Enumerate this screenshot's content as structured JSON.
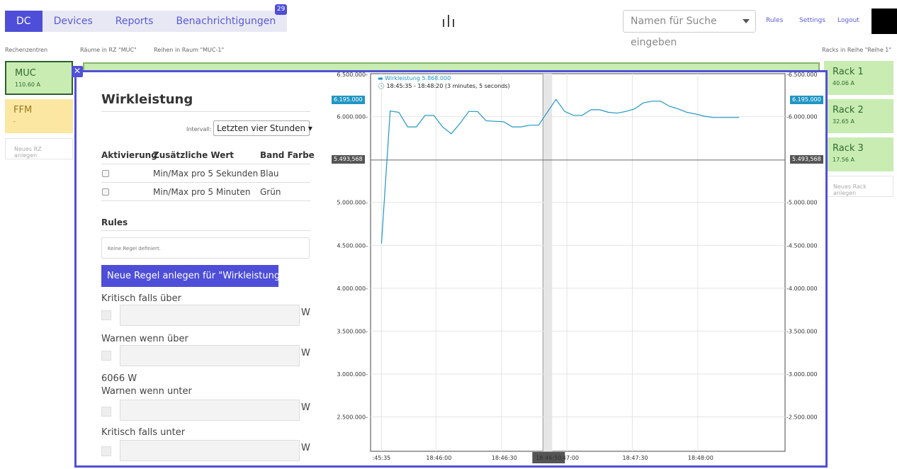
{
  "nav": {
    "tabs": [
      {
        "label": "DC",
        "active": true
      },
      {
        "label": "Devices"
      },
      {
        "label": "Reports"
      },
      {
        "label": "Benachrichtigungen",
        "badge": "29"
      }
    ],
    "search_placeholder": "Namen für Suche eingeben",
    "links": [
      "Rules",
      "Settings",
      "Logout"
    ]
  },
  "columns": {
    "rechenzentren_label": "Rechenzentren",
    "raeume_label": "Räume in RZ \"MUC\"",
    "reihen_label": "Reihen in Raum \"MUC-1\"",
    "racks_label": "Racks in Reihe \"Reihe 1\""
  },
  "datacenters": [
    {
      "name": "MUC",
      "value": "110.60 A",
      "color": "#c8ecb2"
    },
    {
      "name": "FFM",
      "value": "-",
      "color": "#fbe7a1"
    }
  ],
  "new_dc_label": "Neues RZ anlegen",
  "racks": [
    {
      "name": "Rack 1",
      "value": "40.06 A"
    },
    {
      "name": "Rack 2",
      "value": "32.65 A"
    },
    {
      "name": "Rack 3",
      "value": "17.56 A"
    }
  ],
  "new_rack_label": "Neues Rack anlegen",
  "panel": {
    "title": "Wirkleistung",
    "interval_label": "Intervall:",
    "interval_value": "Letzten vier Stunden",
    "table_headers": [
      "Aktivierung",
      "Zusätzliche Wert",
      "Band Farbe"
    ],
    "table_rows": [
      {
        "value": "Min/Max pro 5 Sekunden",
        "color": "Blau"
      },
      {
        "value": "Min/Max pro 5 Minuten",
        "color": "Grün"
      }
    ],
    "rules_title": "Rules",
    "no_rule_text": "Keine Regel definiert.",
    "new_rule_button": "Neue Regel anlegen für \"Wirkleistung\"",
    "thresholds": [
      {
        "label": "Kritisch falls über",
        "unit": "W"
      },
      {
        "label": "Warnen wenn über",
        "unit": "W"
      },
      {
        "label": "Warnen wenn unter",
        "unit": "W"
      },
      {
        "label": "Kritisch falls unter",
        "unit": "W"
      }
    ],
    "current_value": "6066 W"
  },
  "chart_data": {
    "type": "line",
    "series_color": "#2196c4",
    "legend": {
      "name": "Wirkleistung",
      "value": "5.868.000",
      "range": "18:45:35 - 18:48:20  (3 minutes, 5 seconds)"
    },
    "yticks": [
      "6.000.000",
      "5.000.000",
      "4.500.000",
      "4.000.000",
      "3.500.000",
      "3.000.000",
      "2.500.000"
    ],
    "ytick_values": [
      6000000,
      5000000,
      4500000,
      4000000,
      3500000,
      3000000,
      2500000
    ],
    "ytop_label": "6.500.000",
    "xticks": [
      ":45:35",
      "18:46:00",
      "18:46:30",
      "18:46:50",
      ":47:00",
      "18:47:30",
      "18:48:00"
    ],
    "xtick_seconds": [
      5,
      30,
      60,
      80,
      90,
      120,
      150
    ],
    "ylim": [
      2100000,
      6500000
    ],
    "xlim_seconds": [
      0,
      190
    ],
    "max_flag": "6.195.000",
    "cursor_flag": "5.493,568",
    "cursor_value": 5493568,
    "cursor_x": "18:46:50",
    "x_seconds": [
      5,
      9,
      13,
      17,
      21,
      25,
      29,
      33,
      37,
      41,
      45,
      49,
      53,
      57,
      61,
      65,
      69,
      73,
      77,
      81,
      85,
      89,
      93,
      97,
      101,
      105,
      109,
      113,
      117,
      121,
      125,
      129,
      133,
      137,
      141,
      145,
      149,
      153,
      157,
      161,
      165,
      169
    ],
    "values": [
      4520000,
      6065000,
      6050000,
      5880000,
      5880000,
      6015000,
      6015000,
      5880000,
      5800000,
      5920000,
      6060000,
      6060000,
      5950000,
      5945000,
      5940000,
      5880000,
      5880000,
      5900000,
      5900000,
      6050000,
      6200000,
      6060000,
      6015000,
      6015000,
      6080000,
      6080000,
      6050000,
      6040000,
      6060000,
      6090000,
      6160000,
      6180000,
      6180000,
      6120000,
      6090000,
      6050000,
      6030000,
      6005000,
      5990000,
      5990000,
      5990000,
      5990000
    ]
  }
}
